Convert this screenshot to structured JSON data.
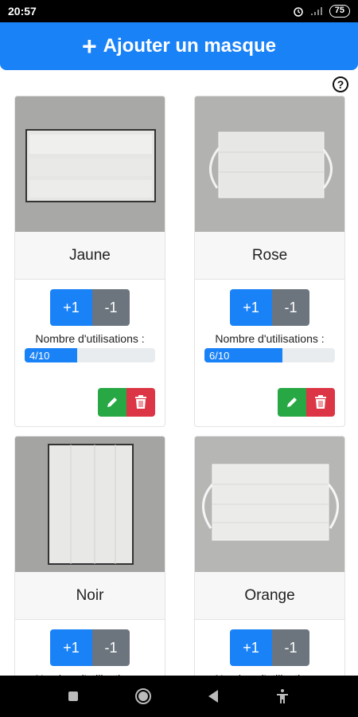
{
  "status_bar": {
    "time": "20:57",
    "battery": "75"
  },
  "add_button": {
    "label": "Ajouter un masque"
  },
  "help_icon": "?",
  "masks": [
    {
      "name": "Jaune",
      "plus_label": "+1",
      "minus_label": "-1",
      "usage_label": "Nombre d'utilisations :",
      "usage_text": "4/10",
      "usage_value": 4,
      "usage_max": 10
    },
    {
      "name": "Rose",
      "plus_label": "+1",
      "minus_label": "-1",
      "usage_label": "Nombre d'utilisations :",
      "usage_text": "6/10",
      "usage_value": 6,
      "usage_max": 10
    },
    {
      "name": "Noir",
      "plus_label": "+1",
      "minus_label": "-1",
      "usage_label": "Nombre d'utilisations :"
    },
    {
      "name": "Orange",
      "plus_label": "+1",
      "minus_label": "-1",
      "usage_label": "Nombre d'utilisations :"
    }
  ],
  "colors": {
    "primary": "#1a82f7",
    "secondary": "#6c757d",
    "success": "#28a745",
    "danger": "#dc3545"
  },
  "icons": {
    "edit": "pencil-icon",
    "delete": "trash-icon"
  }
}
